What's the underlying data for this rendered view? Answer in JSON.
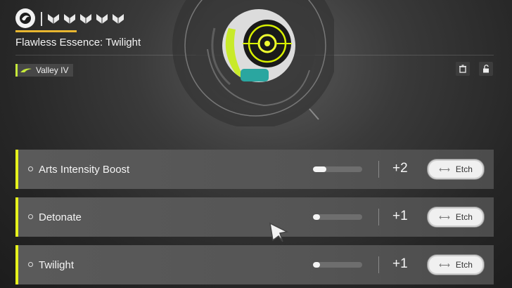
{
  "header": {
    "title": "Flawless Essence: Twilight",
    "rank_icons": [
      "rank-chevron-icon",
      "rank-chevron-icon",
      "rank-chevron-icon",
      "rank-chevron-icon",
      "rank-chevron-icon"
    ]
  },
  "tag": {
    "label": "Valley IV",
    "accent_color": "#c6e93a"
  },
  "actions": {
    "delete_icon": "trash-icon",
    "lock_icon": "unlock-icon"
  },
  "stats": [
    {
      "name": "Arts Intensity Boost",
      "progress": 0.27,
      "level": "+2",
      "button": "Etch"
    },
    {
      "name": "Detonate",
      "progress": 0.14,
      "level": "+1",
      "button": "Etch"
    },
    {
      "name": "Twilight",
      "progress": 0.14,
      "level": "+1",
      "button": "Etch"
    }
  ],
  "colors": {
    "stat_bar": "#e6f21c",
    "accent_line": "#e8b630"
  }
}
